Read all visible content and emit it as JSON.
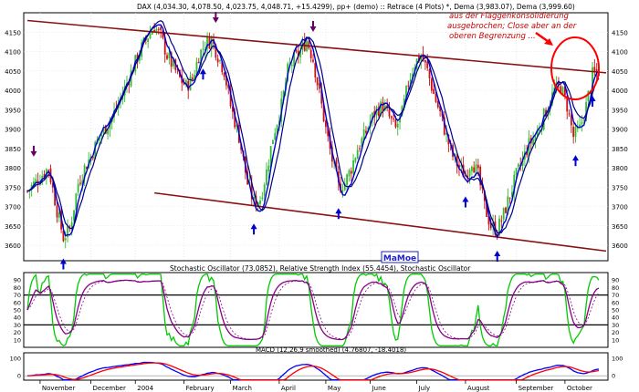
{
  "chart_data": [
    {
      "type": "candlestick",
      "title": "DAX (4,034.30, 4,078.50, 4,023.75, 4,048.71, +15.4299), pp+ (demo) :: Retrace (4 Plots) *, Dema (3,983.07), Dema (3,999.60)",
      "annotation": [
        "aus der Flaggenkonsolidierung",
        "ausgebrochen; Close aber an der",
        "oberen Begrenzung ..."
      ],
      "watermark": "MaMoe",
      "ylim": [
        3560,
        4200
      ],
      "yticks": [
        3600,
        3650,
        3700,
        3750,
        3800,
        3850,
        3900,
        3950,
        4000,
        4050,
        4100,
        4150
      ],
      "series": [
        {
          "name": "Dema 1",
          "color": "#0000cc"
        },
        {
          "name": "Dema 2",
          "color": "#000088"
        }
      ],
      "close_path": [
        [
          0,
          3740
        ],
        [
          5,
          3770
        ],
        [
          10,
          3800
        ],
        [
          14,
          3690
        ],
        [
          17,
          3620
        ],
        [
          20,
          3640
        ],
        [
          24,
          3760
        ],
        [
          27,
          3800
        ],
        [
          30,
          3830
        ],
        [
          34,
          3880
        ],
        [
          40,
          3930
        ],
        [
          45,
          3990
        ],
        [
          50,
          4060
        ],
        [
          54,
          4110
        ],
        [
          57,
          4140
        ],
        [
          60,
          4165
        ],
        [
          63,
          4140
        ],
        [
          66,
          4090
        ],
        [
          69,
          4060
        ],
        [
          72,
          4030
        ],
        [
          75,
          4010
        ],
        [
          78,
          4030
        ],
        [
          81,
          4090
        ],
        [
          84,
          4120
        ],
        [
          87,
          4130
        ],
        [
          90,
          4090
        ],
        [
          93,
          4050
        ],
        [
          96,
          3960
        ],
        [
          100,
          3880
        ],
        [
          104,
          3760
        ],
        [
          107,
          3710
        ],
        [
          110,
          3720
        ],
        [
          113,
          3790
        ],
        [
          116,
          3880
        ],
        [
          120,
          3960
        ],
        [
          123,
          4050
        ],
        [
          126,
          4080
        ],
        [
          129,
          4100
        ],
        [
          132,
          4130
        ],
        [
          135,
          4080
        ],
        [
          138,
          3990
        ],
        [
          141,
          3900
        ],
        [
          144,
          3820
        ],
        [
          147,
          3750
        ],
        [
          150,
          3760
        ],
        [
          153,
          3800
        ],
        [
          156,
          3850
        ],
        [
          159,
          3880
        ],
        [
          162,
          3920
        ],
        [
          165,
          3950
        ],
        [
          168,
          3960
        ],
        [
          171,
          3930
        ],
        [
          174,
          3900
        ],
        [
          177,
          3940
        ],
        [
          180,
          4020
        ],
        [
          183,
          4070
        ],
        [
          186,
          4090
        ],
        [
          189,
          4050
        ],
        [
          192,
          3990
        ],
        [
          195,
          3940
        ],
        [
          198,
          3880
        ],
        [
          201,
          3830
        ],
        [
          204,
          3800
        ],
        [
          207,
          3780
        ],
        [
          210,
          3820
        ],
        [
          213,
          3780
        ],
        [
          216,
          3700
        ],
        [
          219,
          3650
        ],
        [
          222,
          3640
        ],
        [
          225,
          3680
        ],
        [
          228,
          3730
        ],
        [
          231,
          3780
        ],
        [
          234,
          3820
        ],
        [
          237,
          3860
        ],
        [
          240,
          3880
        ],
        [
          243,
          3920
        ],
        [
          246,
          3960
        ],
        [
          249,
          4000
        ],
        [
          252,
          4010
        ],
        [
          255,
          3960
        ],
        [
          258,
          3880
        ],
        [
          261,
          3900
        ],
        [
          264,
          3960
        ],
        [
          267,
          4040
        ],
        [
          270,
          4050
        ]
      ],
      "channel_upper": [
        [
          0,
          4180
        ],
        [
          270,
          4045
        ]
      ],
      "channel_lower": [
        [
          60,
          3735
        ],
        [
          270,
          3585
        ]
      ],
      "support_arrows": [
        17,
        83,
        107,
        147,
        207,
        222,
        259,
        267
      ],
      "resistance_arrows": [
        3,
        60,
        89,
        135
      ],
      "xticks": [
        {
          "label": "November",
          "x": 6
        },
        {
          "label": "December",
          "x": 30
        },
        {
          "label": "2004",
          "x": 51
        },
        {
          "label": "February",
          "x": 74
        },
        {
          "label": "March",
          "x": 96
        },
        {
          "label": "April",
          "x": 119
        },
        {
          "label": "May",
          "x": 141
        },
        {
          "label": "June",
          "x": 162
        },
        {
          "label": "July",
          "x": 184
        },
        {
          "label": "August",
          "x": 207
        },
        {
          "label": "September",
          "x": 231
        },
        {
          "label": "October",
          "x": 254
        }
      ]
    },
    {
      "type": "line",
      "title": "Stochastic Oscillator (73.0852), Relative Strength Index (55.4454), Stochastic Oscillator",
      "ylim": [
        0,
        100
      ],
      "yticks": [
        10,
        20,
        30,
        40,
        50,
        60,
        70,
        80,
        90
      ],
      "reference_lines": [
        30,
        70
      ],
      "series": [
        {
          "name": "Stochastic Oscillator",
          "value": 73.0852,
          "color": "#00cc00"
        },
        {
          "name": "Relative Strength Index",
          "value": 55.4454,
          "color": "#880088"
        }
      ]
    },
    {
      "type": "line",
      "title": "MACD (12,26,9 smoothed) (4.76807, -18.4018)",
      "ylim": [
        -25,
        130
      ],
      "yticks": [
        0,
        100
      ],
      "reference_lines": [
        0
      ],
      "series": [
        {
          "name": "MACD",
          "value": 4.76807,
          "color": "#0000ff"
        },
        {
          "name": "Signal",
          "value": -18.4018,
          "color": "#ff0000"
        }
      ]
    }
  ]
}
